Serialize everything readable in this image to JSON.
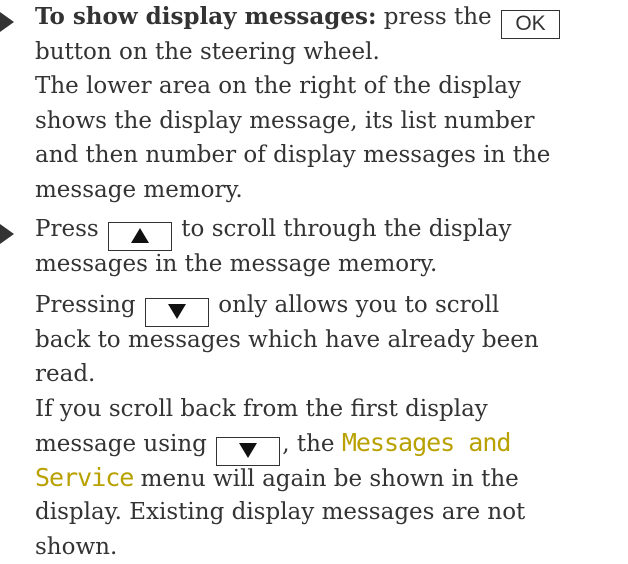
{
  "step1": {
    "bold_intro": "To show display messages:",
    "text_a": " press the ",
    "key_ok": "OK",
    "line2": "button on the steering wheel.",
    "line3": "The lower area on the right of the display",
    "line4": "shows the display message, its list number",
    "line5": "and then number of display messages in the",
    "line6": "message memory."
  },
  "step2": {
    "press": "Press ",
    "text_a": " to scroll through the display",
    "line2": "messages in the message memory.",
    "pressing": "Pressing ",
    "text_b": " only allows you to scroll",
    "line4": "back to messages which have already been",
    "line5": "read.",
    "line6": "If you scroll back from the first display",
    "line7a": "message using ",
    "line7b": ", the ",
    "menu_part1": "Messages and",
    "menu_part2": "Service",
    "line8b": " menu will again be shown in the",
    "line9": "display. Existing display messages are not",
    "line10": "shown."
  },
  "colors": {
    "text": "#333333",
    "menu_highlight": "#b8a100"
  },
  "icons": {
    "bullet": "right-pointing-triangle",
    "up_key": "up-arrow-key",
    "down_key": "down-arrow-key"
  }
}
